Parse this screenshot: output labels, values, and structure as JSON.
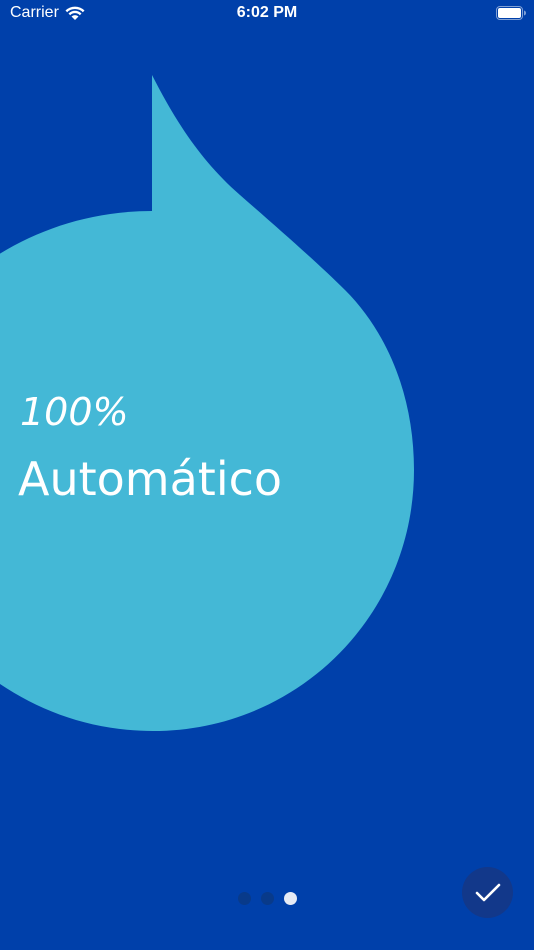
{
  "status_bar": {
    "carrier": "Carrier",
    "time": "6:02 PM",
    "wifi_icon": "wifi-icon",
    "battery_icon": "battery-icon"
  },
  "slide": {
    "subtitle": "100%",
    "title": "Automático",
    "bubble_color": "#44b8d6",
    "background_color": "#0040aa"
  },
  "pager": {
    "count": 3,
    "active_index": 2
  },
  "done_button": {
    "icon": "checkmark-icon",
    "color": "#12388a"
  }
}
